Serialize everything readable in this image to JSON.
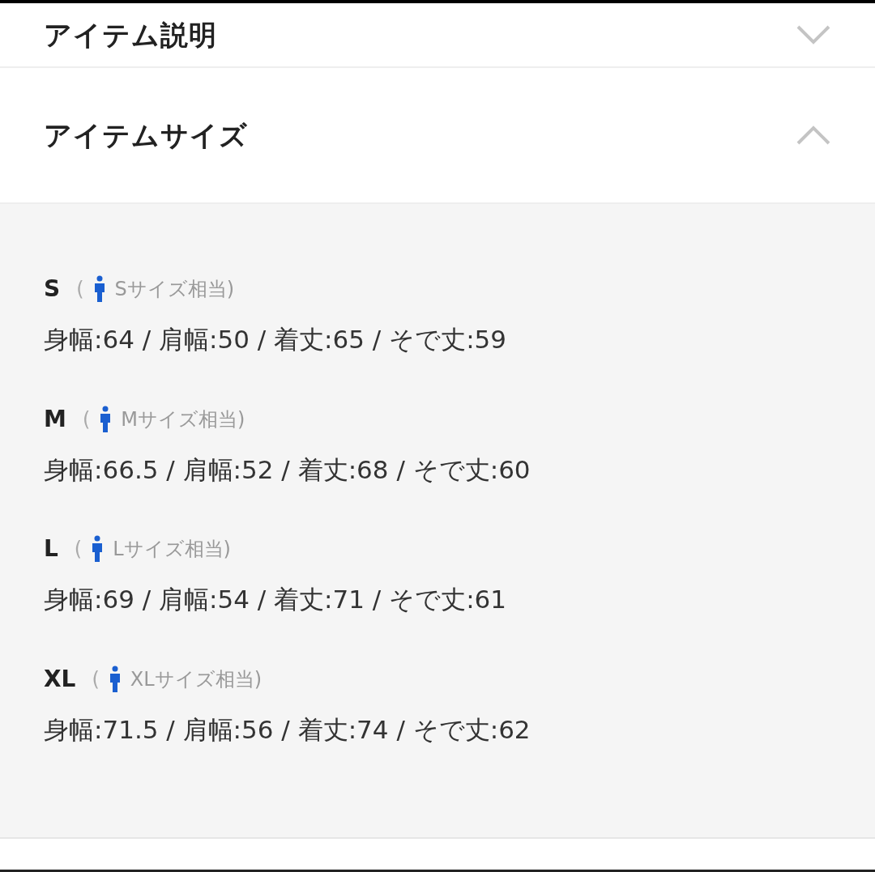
{
  "sections": [
    {
      "title": "アイテム説明",
      "expanded": false
    },
    {
      "title": "アイテムサイズ",
      "expanded": true,
      "sizes": [
        {
          "size": "S",
          "paren": "(",
          "note": "Sサイズ相当)",
          "measurements": "身幅:64 / 肩幅:50 / 着丈:65 / そで丈:59"
        },
        {
          "size": "M",
          "paren": "(",
          "note": "Mサイズ相当)",
          "measurements": "身幅:66.5 / 肩幅:52 / 着丈:68 / そで丈:60"
        },
        {
          "size": "L",
          "paren": "(",
          "note": "Lサイズ相当)",
          "measurements": "身幅:69 / 肩幅:54 / 着丈:71 / そで丈:61"
        },
        {
          "size": "XL",
          "paren": "(",
          "note": "XLサイズ相当)",
          "measurements": "身幅:71.5 / 肩幅:56 / 着丈:74 / そで丈:62"
        }
      ]
    }
  ]
}
